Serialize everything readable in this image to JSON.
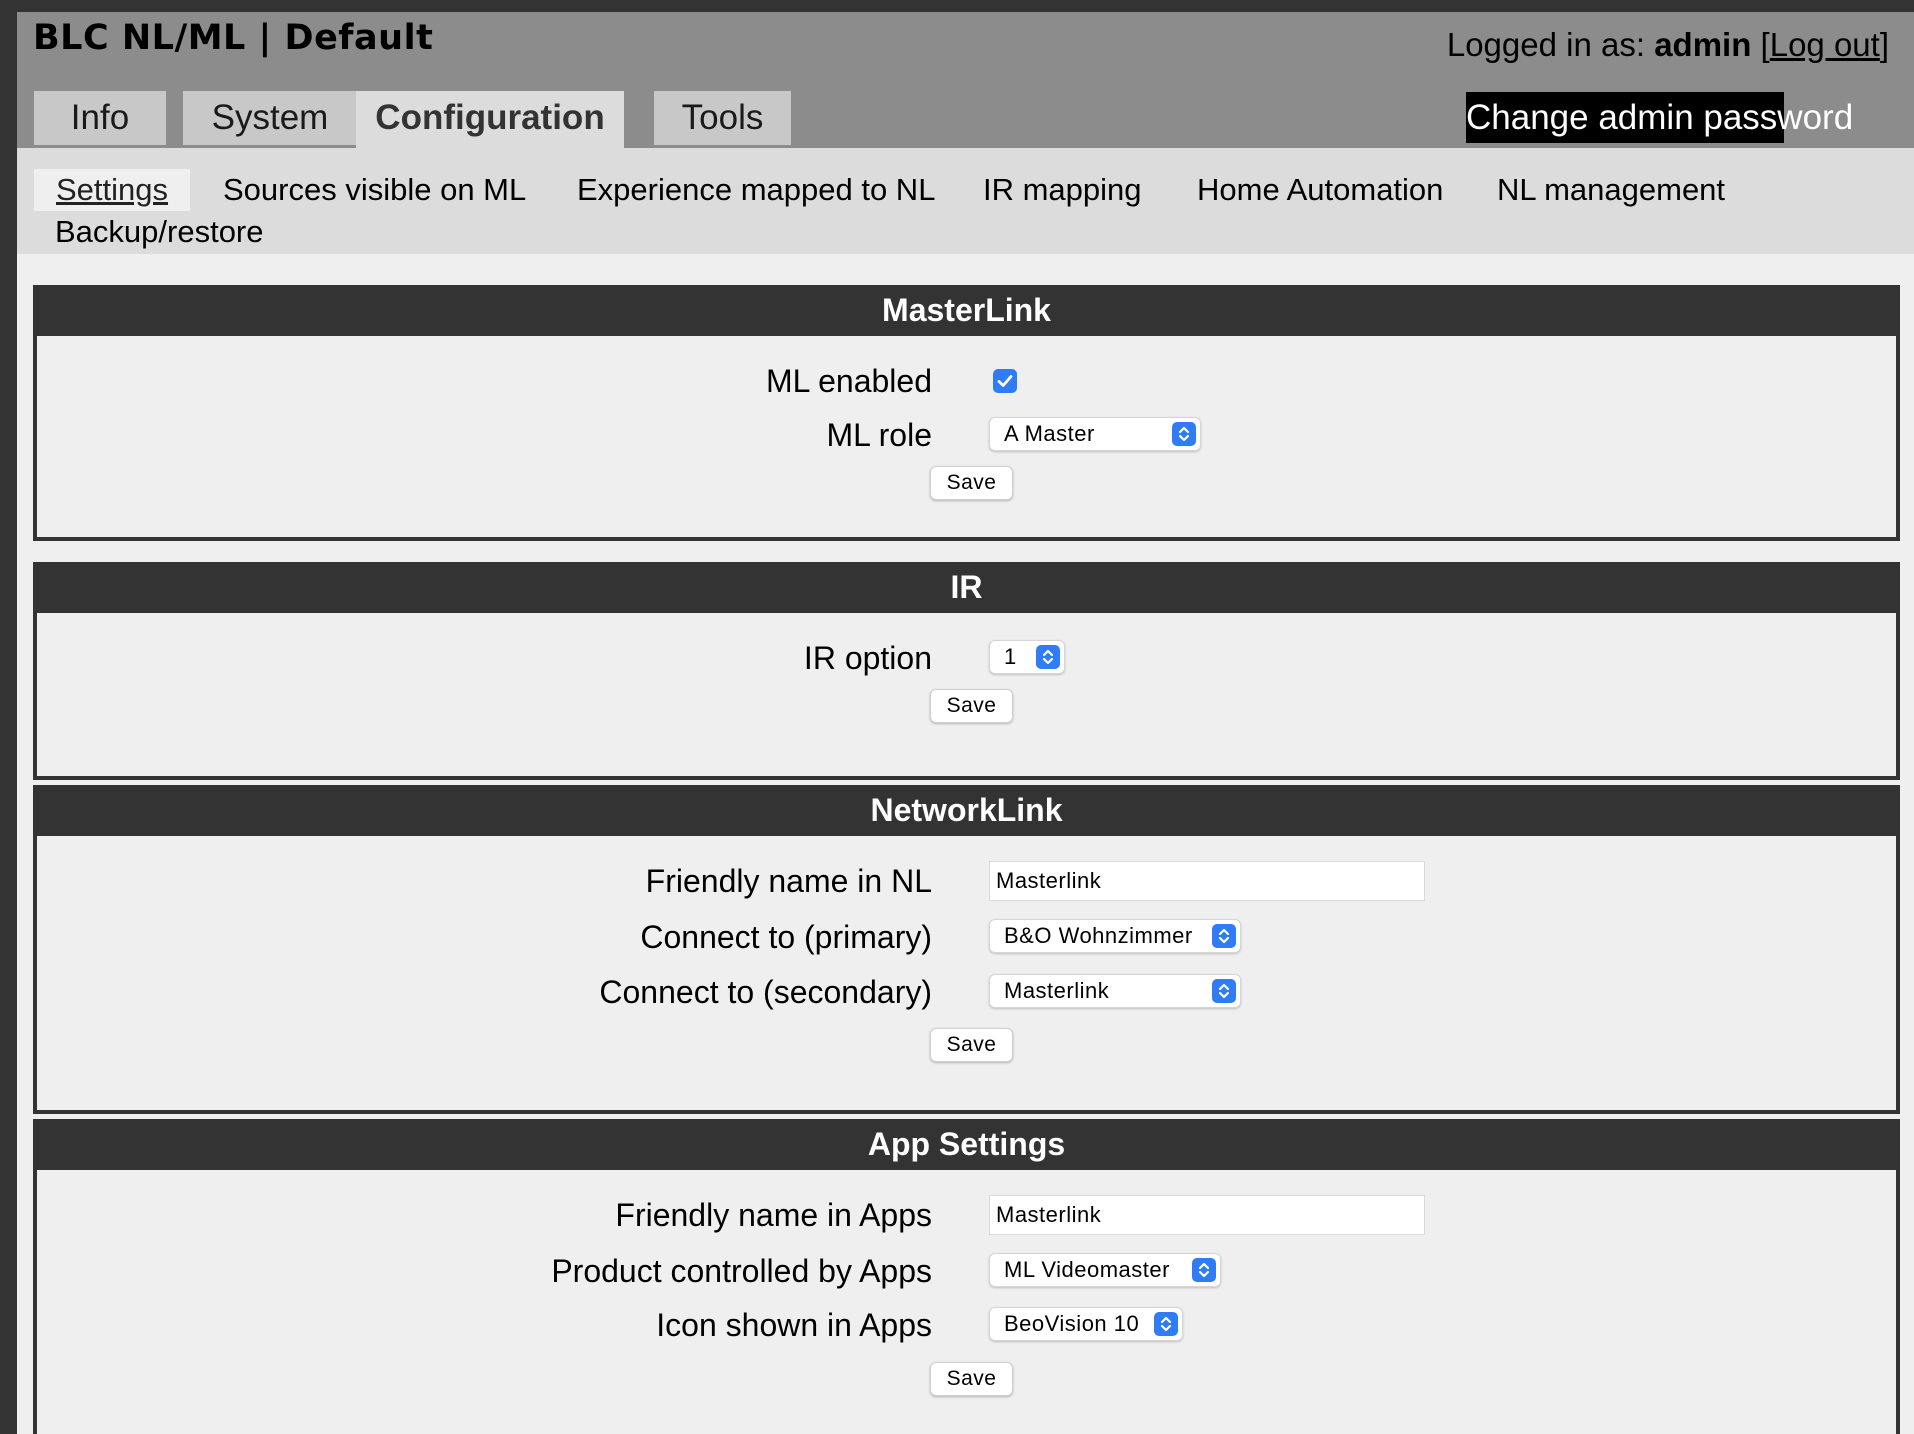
{
  "header": {
    "title": "BLC NL/ML | Default",
    "login_prefix": "Logged in as: ",
    "username": "admin",
    "bracket_open": "[",
    "logout_label": "Log out",
    "bracket_close": "]",
    "tabs": [
      {
        "label": "Info"
      },
      {
        "label": "System"
      },
      {
        "label": "Configuration",
        "active": true
      },
      {
        "label": "Tools"
      }
    ],
    "change_password_label": "Change admin password"
  },
  "subnav": {
    "items": [
      {
        "label": "Settings",
        "active": true
      },
      {
        "label": "Sources visible on ML"
      },
      {
        "label": "Experience mapped to NL"
      },
      {
        "label": "IR mapping"
      },
      {
        "label": "Home Automation"
      },
      {
        "label": "NL management"
      },
      {
        "label": "Backup/restore"
      }
    ]
  },
  "panels": {
    "masterlink": {
      "title": "MasterLink",
      "ml_enabled_label": "ML enabled",
      "ml_enabled": true,
      "ml_role_label": "ML role",
      "ml_role_value": "A Master",
      "save_label": "Save"
    },
    "ir": {
      "title": "IR",
      "ir_option_label": "IR option",
      "ir_option_value": "1",
      "save_label": "Save"
    },
    "networklink": {
      "title": "NetworkLink",
      "friendly_name_label": "Friendly name in NL",
      "friendly_name_value": "Masterlink",
      "primary_label": "Connect to (primary)",
      "primary_value": "B&O Wohnzimmer",
      "secondary_label": "Connect to (secondary)",
      "secondary_value": "Masterlink",
      "save_label": "Save"
    },
    "app_settings": {
      "title": "App Settings",
      "friendly_name_label": "Friendly name in Apps",
      "friendly_name_value": "Masterlink",
      "product_label": "Product controlled by Apps",
      "product_value": "ML Videomaster",
      "icon_label": "Icon shown in Apps",
      "icon_value": "BeoVision 10",
      "save_label": "Save"
    }
  },
  "colors": {
    "header_bg": "#8c8c8c",
    "panel_header_bg": "#333333",
    "accent_blue": "#2f7cf6"
  },
  "icons": {
    "checkbox": "checkmark-icon",
    "select": "select-arrows-icon"
  }
}
